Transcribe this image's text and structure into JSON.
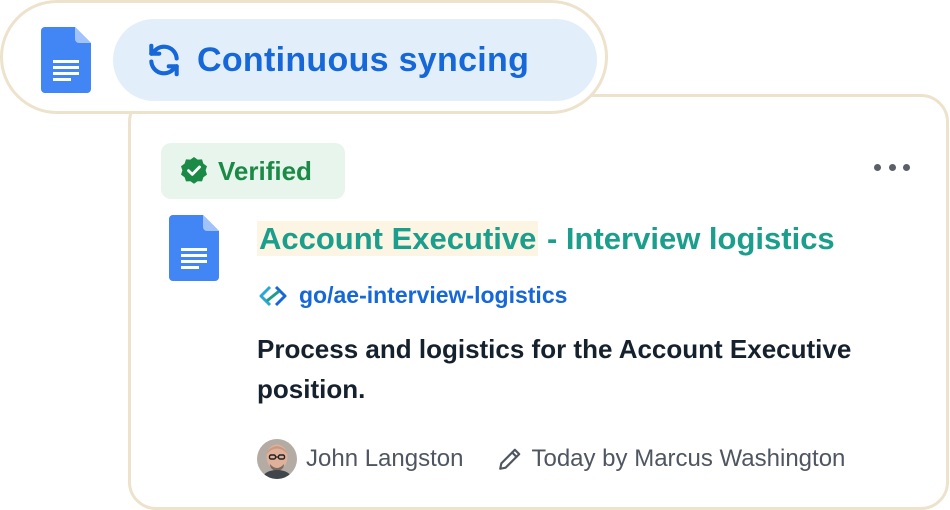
{
  "sync": {
    "label": "Continuous syncing",
    "doc_icon": "google-docs-icon",
    "icon": "sync-icon"
  },
  "card": {
    "badge": {
      "label": "Verified",
      "icon": "verified-check-icon"
    },
    "menu_icon": "more-horizontal-icon",
    "doc_icon": "google-docs-icon",
    "title_highlight": "Account Executive",
    "title_rest": " - Interview logistics",
    "golink": {
      "icon": "golink-icon",
      "label": "go/ae-interview-logistics"
    },
    "description": "Process and logistics for the Account Executive position.",
    "owner": {
      "name": "John Langston",
      "avatar": "avatar"
    },
    "edited": {
      "icon": "pencil-icon",
      "text": "Today by Marcus Washington"
    }
  },
  "colors": {
    "accent_blue": "#1667d8",
    "title_teal": "#1b9e8c",
    "verified_green": "#1c8a47",
    "border_beige": "#ede3cc"
  }
}
